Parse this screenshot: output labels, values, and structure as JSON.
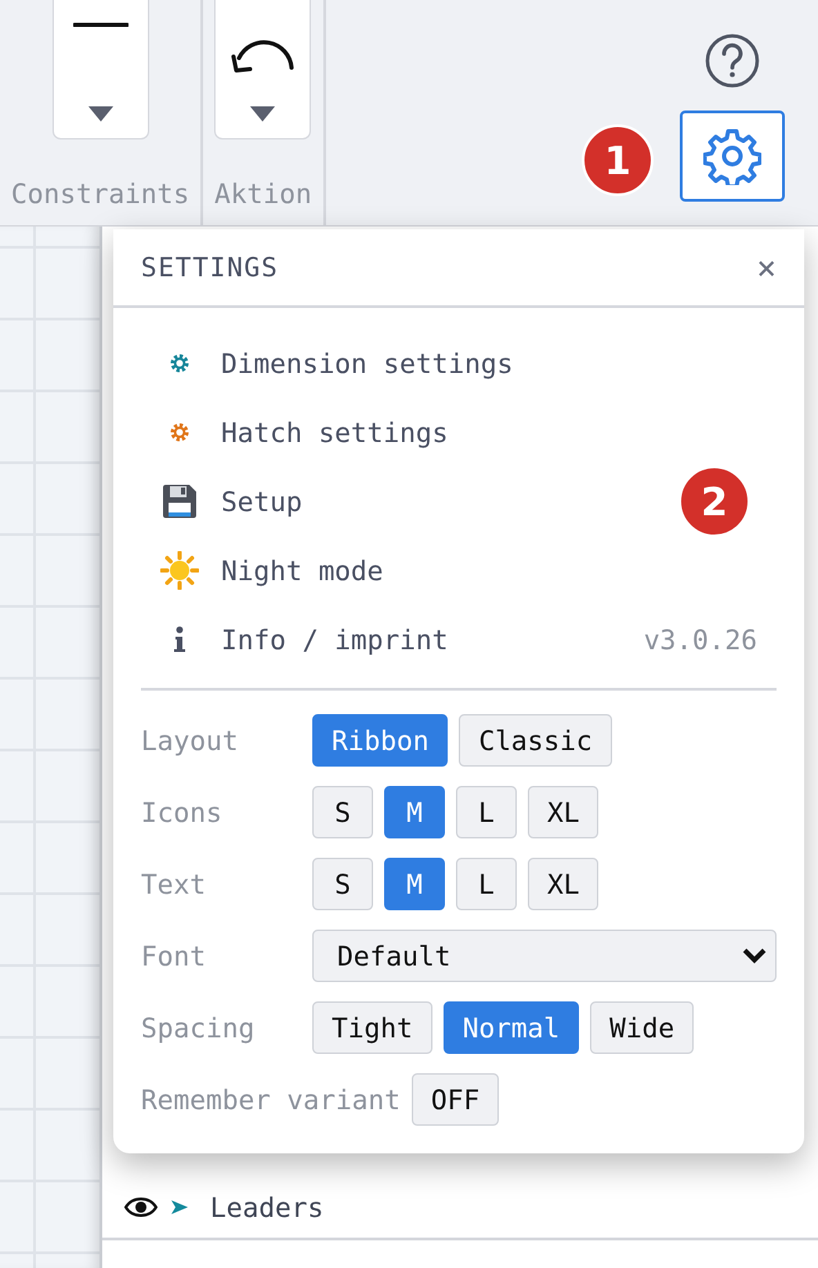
{
  "ribbon": {
    "groups": [
      {
        "label": "Constraints",
        "kind": "line"
      },
      {
        "label": "Aktion",
        "kind": "undo"
      }
    ]
  },
  "callouts": [
    "1",
    "2"
  ],
  "settings": {
    "title": "SETTINGS",
    "close": "×",
    "menu": [
      {
        "label": "Dimension settings"
      },
      {
        "label": "Hatch settings"
      },
      {
        "label": "Setup"
      },
      {
        "label": "Night mode"
      },
      {
        "label": "Info / imprint",
        "note": "v3.0.26"
      }
    ],
    "options": [
      {
        "label": "Layout",
        "kind": "segmented",
        "choices": [
          {
            "label": "Ribbon",
            "selected": true
          },
          {
            "label": "Classic",
            "selected": false
          }
        ]
      },
      {
        "label": "Icons",
        "kind": "segmented",
        "choices": [
          {
            "label": "S",
            "selected": false
          },
          {
            "label": "M",
            "selected": true
          },
          {
            "label": "L",
            "selected": false
          },
          {
            "label": "XL",
            "selected": false
          }
        ]
      },
      {
        "label": "Text",
        "kind": "segmented",
        "choices": [
          {
            "label": "S",
            "selected": false
          },
          {
            "label": "M",
            "selected": true
          },
          {
            "label": "L",
            "selected": false
          },
          {
            "label": "XL",
            "selected": false
          }
        ]
      },
      {
        "label": "Font",
        "kind": "select",
        "value": "Default"
      },
      {
        "label": "Spacing",
        "kind": "segmented",
        "choices": [
          {
            "label": "Tight",
            "selected": false
          },
          {
            "label": "Normal",
            "selected": true
          },
          {
            "label": "Wide",
            "selected": false
          }
        ]
      },
      {
        "label": "Remember variant",
        "kind": "toggle",
        "value": "OFF",
        "on": false
      }
    ]
  },
  "layers": [
    {
      "label": "Leaders",
      "visible": true
    }
  ]
}
